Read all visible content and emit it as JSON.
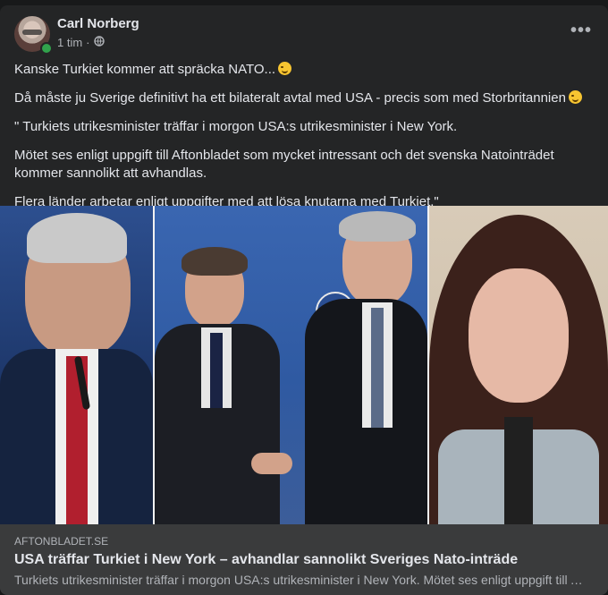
{
  "post": {
    "author": "Carl Norberg",
    "timestamp": "1 tim",
    "separator": "·",
    "privacy_icon": "globe-icon",
    "more_icon": "more-options-icon",
    "more_label": "•••",
    "paragraphs": [
      "Kanske Turkiet kommer att spräcka NATO...",
      "Då måste ju Sverige definitivt ha ett bilateralt avtal med USA - precis som med Storbritannien",
      "\" Turkiets utrikesminister träffar i morgon USA:s utrikesminister i New York.",
      "Mötet ses enligt uppgift till Aftonbladet som mycket intressant och det svenska Natointrädet kommer sannolikt att avhandlas.",
      "Flera länder arbetar enligt uppgifter med att lösa knutarna med Turkiet.\""
    ]
  },
  "link": {
    "domain": "AFTONBLADET.SE",
    "headline": "USA träffar Turkiet i New York – avhandlar sannolikt Sveriges Nato-inträde",
    "snippet": "Turkiets utrikesminister träffar i morgon USA:s utrikesminister i New York. Mötet ses enligt uppgift till Aftonbladet som mycket intressant och det svenska Natointrädet kommer sannolikt att avhandlas."
  },
  "colors": {
    "background": "#18191a",
    "card": "#242526",
    "link_card": "#3a3b3c",
    "online": "#31a24c"
  }
}
